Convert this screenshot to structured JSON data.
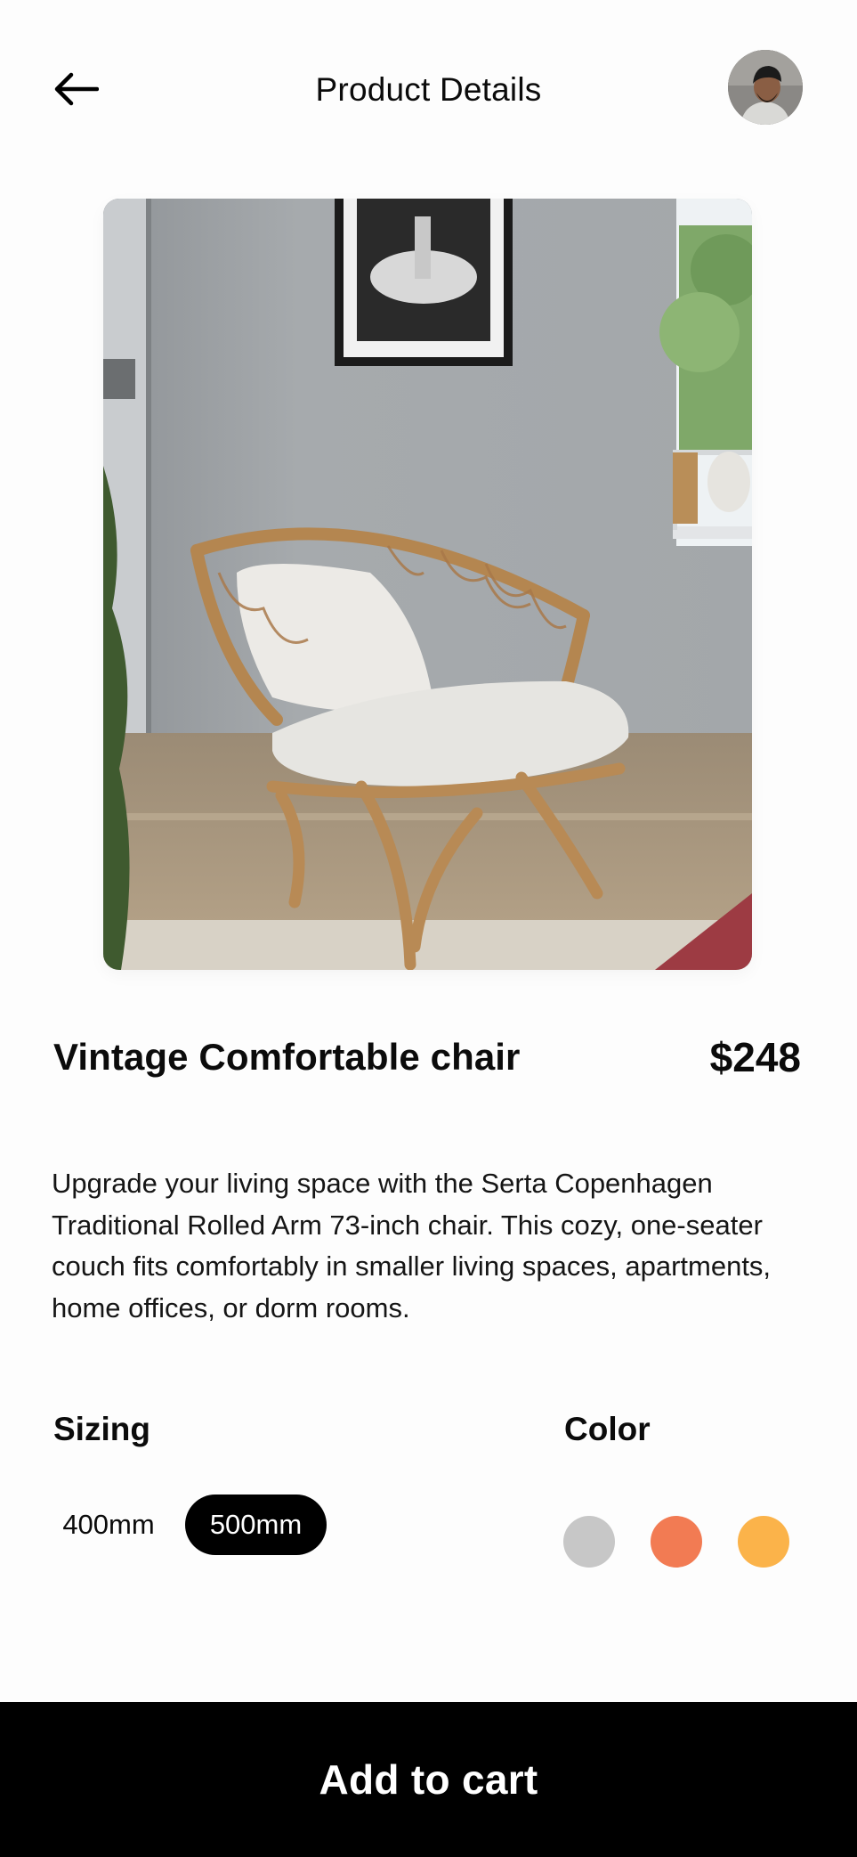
{
  "header": {
    "title": "Product Details",
    "back_icon": "arrow-left-icon",
    "avatar_icon": "user-avatar"
  },
  "product": {
    "name": "Vintage Comfortable chair",
    "price": "$248",
    "description": "Upgrade your living space with the Serta Copenhagen Traditional Rolled Arm 73-inch chair. This cozy, one-seater couch fits comfortably in smaller living spaces, apartments, home offices, or dorm rooms.",
    "image": "rattan-armchair-photo"
  },
  "sizing": {
    "label": "Sizing",
    "options": [
      "400mm",
      "500mm"
    ],
    "selected": "500mm"
  },
  "color": {
    "label": "Color",
    "swatches": [
      "#c7c7c7",
      "#f27b53",
      "#fbb34a"
    ]
  },
  "cart": {
    "label": "Add to cart"
  }
}
